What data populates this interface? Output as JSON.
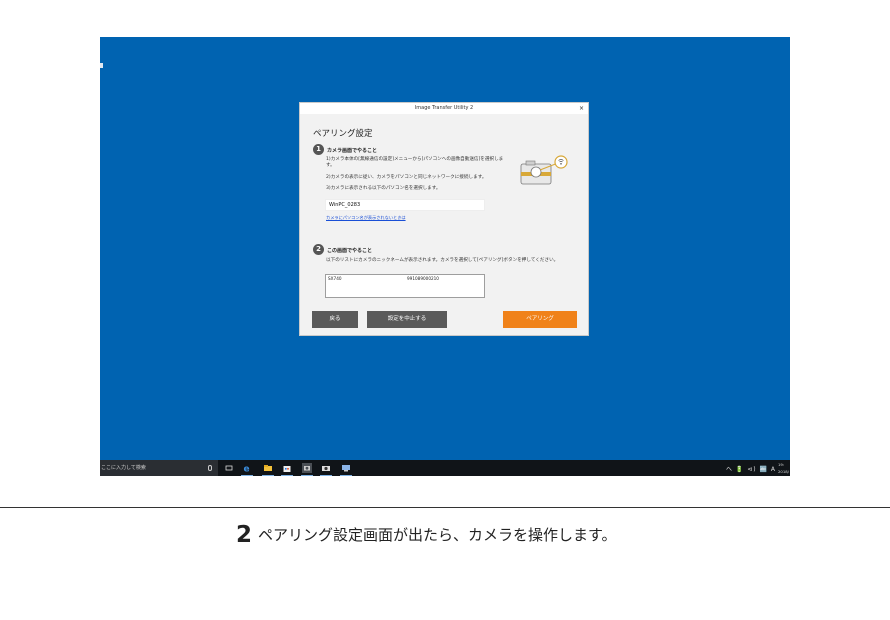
{
  "dialog": {
    "title": "Image Transfer Utility 2",
    "close_glyph": "×",
    "heading": "ペアリング設定",
    "step1": {
      "number": "1",
      "title": "カメラ画面でやること",
      "lines": [
        "1)カメラ本体の[無線通信の設定]メニューから[パソコンへの画像自動送信]を選択しま",
        "す。",
        "2)カメラの表示に従い、カメラをパソコンと同じネットワークに接続します。",
        "3)カメラに表示される以下のパソコン名を選択します。"
      ],
      "pc_name": "WinPC_0283",
      "help_link": "カメラにパソコン名が表示されないときは"
    },
    "step2": {
      "number": "2",
      "title": "この画面でやること",
      "text": "以下のリストにカメラのニックネームが表示されます。カメラを選択して[ペアリング]ボタンを押してください。",
      "cameras": [
        {
          "name": "SX740",
          "serial": "991089000210"
        }
      ]
    },
    "buttons": {
      "back": "戻る",
      "cancel": "設定を中止する",
      "pair": "ペアリング"
    }
  },
  "taskbar": {
    "search_placeholder": "ここに入力して検索",
    "tray_text": "へ 🔋 ⊲) 🔤 A",
    "clock_time": "19:",
    "clock_date": "2018/"
  },
  "caption": {
    "step_number": "2",
    "text": "ペアリング設定画面が出たら、カメラを操作します。"
  },
  "colors": {
    "desktop": "#0063b1",
    "pair_button": "#f0821a",
    "secondary_button": "#5a5a5a",
    "link": "#1a4fd6"
  }
}
